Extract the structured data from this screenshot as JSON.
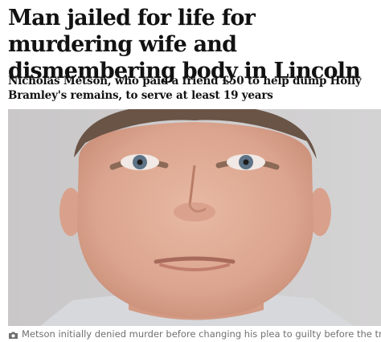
{
  "article": {
    "headline": "Man jailed for life for murdering wife and dismembering body in Lincoln",
    "standfirst": "Nicholas Metson, who paid a friend £50 to help dump Holly Bramley's remains, to serve at least 19 years",
    "caption": "Metson initially denied murder before changing his plea to guilty before the trial. Photograph:"
  },
  "icons": {
    "caption_icon": "camera-icon"
  },
  "colors": {
    "text": "#121212",
    "caption": "#707070",
    "photo_background": "#cdcccd"
  }
}
